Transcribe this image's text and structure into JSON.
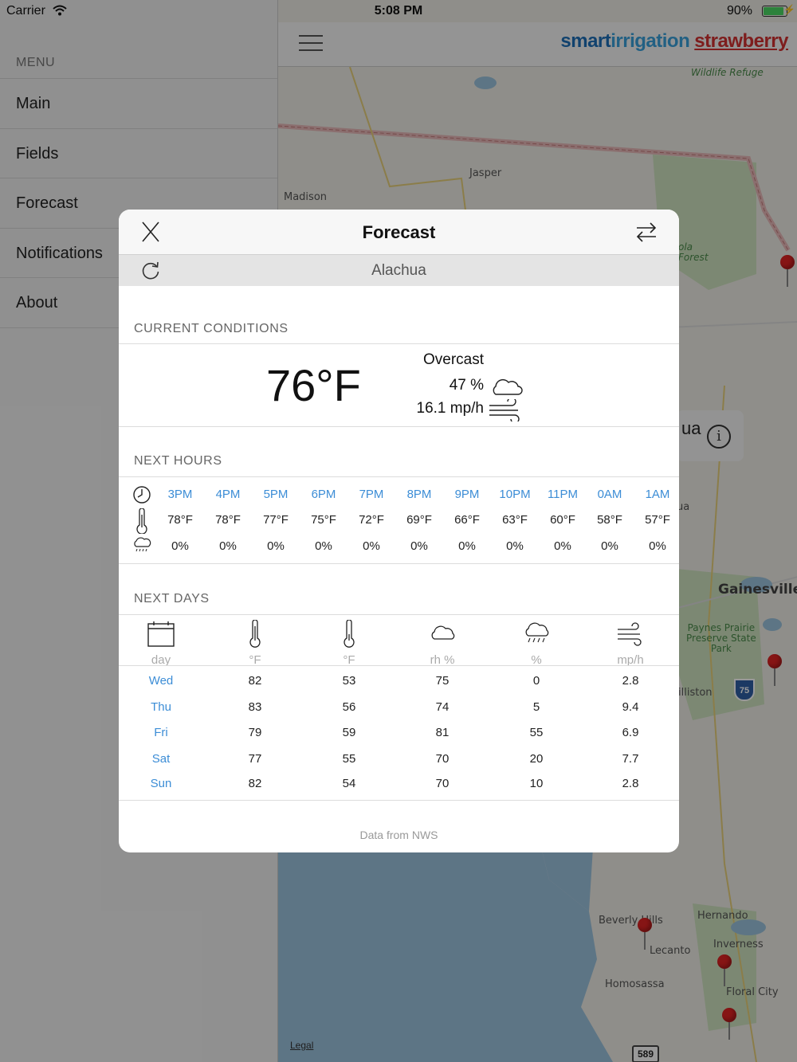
{
  "status_bar": {
    "carrier": "Carrier",
    "time": "5:08 PM",
    "battery": "90%",
    "battery_level": 0.9
  },
  "menu": {
    "title": "MENU",
    "items": [
      {
        "label": "Main"
      },
      {
        "label": "Fields"
      },
      {
        "label": "Forecast"
      },
      {
        "label": "Notifications"
      },
      {
        "label": "About"
      }
    ]
  },
  "app_header": {
    "logo_part1": "smart",
    "logo_part2": "irrigation",
    "logo_part3": "strawberry"
  },
  "map": {
    "labels": {
      "wildlife_refuge": "Wildlife Refuge",
      "jasper": "Jasper",
      "madison": "Madison",
      "ola_forest": "ola\nForest",
      "gainesville": "Gainesville",
      "paynes_prairie": "Paynes Prairie\nPreserve State\nPark",
      "williston": "illiston",
      "beverly_hills": "Beverly Hills",
      "hernando": "Hernando",
      "lecanto": "Lecanto",
      "inverness": "Inverness",
      "homosassa": "Homosassa",
      "floral_city": "Floral City",
      "alachua_partial": "ua",
      "alachua_partial2": "ua",
      "interstate": "75",
      "highway": "589"
    },
    "legal": "Legal"
  },
  "modal": {
    "title": "Forecast",
    "location": "Alachua",
    "current": {
      "section": "CURRENT CONDITIONS",
      "temp": "76°F",
      "condition": "Overcast",
      "humidity": "47 %",
      "wind": "16.1 mp/h"
    },
    "hours": {
      "section": "NEXT HOURS",
      "items": [
        {
          "hour": "3PM",
          "temp": "78°F",
          "precip": "0%"
        },
        {
          "hour": "4PM",
          "temp": "78°F",
          "precip": "0%"
        },
        {
          "hour": "5PM",
          "temp": "77°F",
          "precip": "0%"
        },
        {
          "hour": "6PM",
          "temp": "75°F",
          "precip": "0%"
        },
        {
          "hour": "7PM",
          "temp": "72°F",
          "precip": "0%"
        },
        {
          "hour": "8PM",
          "temp": "69°F",
          "precip": "0%"
        },
        {
          "hour": "9PM",
          "temp": "66°F",
          "precip": "0%"
        },
        {
          "hour": "10PM",
          "temp": "63°F",
          "precip": "0%"
        },
        {
          "hour": "11PM",
          "temp": "60°F",
          "precip": "0%"
        },
        {
          "hour": "0AM",
          "temp": "58°F",
          "precip": "0%"
        },
        {
          "hour": "1AM",
          "temp": "57°F",
          "precip": "0%"
        }
      ]
    },
    "days": {
      "section": "NEXT DAYS",
      "headers": [
        "day",
        "°F",
        "°F",
        "rh %",
        "%",
        "mp/h"
      ],
      "rows": [
        [
          "Wed",
          "82",
          "53",
          "75",
          "0",
          "2.8"
        ],
        [
          "Thu",
          "83",
          "56",
          "74",
          "5",
          "9.4"
        ],
        [
          "Fri",
          "79",
          "59",
          "81",
          "55",
          "6.9"
        ],
        [
          "Sat",
          "77",
          "55",
          "70",
          "20",
          "7.7"
        ],
        [
          "Sun",
          "82",
          "54",
          "70",
          "10",
          "2.8"
        ]
      ]
    },
    "footer": "Data from NWS"
  },
  "colors": {
    "accent": "#3c8dd6",
    "pin": "#e02323",
    "logo_blue": "#1d6fb8",
    "logo_red": "#d23131"
  }
}
